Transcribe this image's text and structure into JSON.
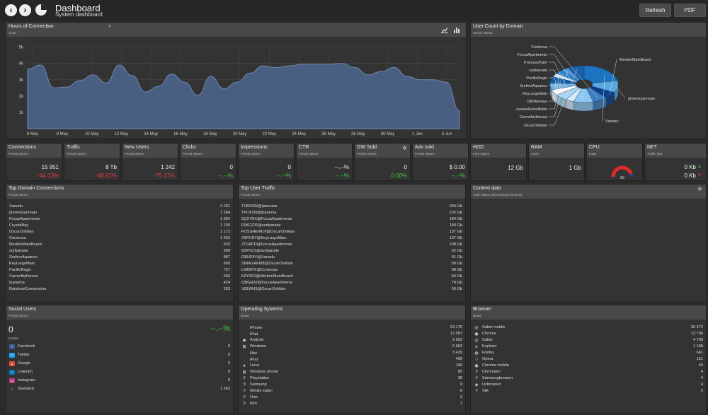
{
  "header": {
    "title": "Dashboard",
    "subtitle": "System dashboard",
    "refresh_label": "Refresh",
    "pdf_label": "PDF"
  },
  "hours_panel": {
    "title": "Hours of Connection",
    "subtitle": "Chart"
  },
  "chart_data": {
    "type": "area",
    "title": "Hours of Connection",
    "x_ticks": [
      "6 May",
      "8 May",
      "10 May",
      "12 May",
      "14 May",
      "16 May",
      "18 May",
      "20 May",
      "22 May",
      "24 May",
      "26 May",
      "28 May",
      "30 May",
      "1 Jun",
      "3 Jun"
    ],
    "y_ticks": [
      "1k",
      "2k",
      "3k",
      "4k",
      "5k"
    ],
    "ylim": [
      0,
      5200
    ],
    "grid": true,
    "color": "#4e6790",
    "x_index": [
      0,
      1,
      2,
      3,
      4,
      5,
      6,
      7,
      8,
      9,
      10,
      11,
      12,
      13,
      14,
      15,
      16,
      17,
      18,
      19,
      20,
      21,
      22,
      23,
      24,
      25,
      26,
      27,
      28,
      29,
      30,
      31,
      32,
      33
    ],
    "values": [
      3650,
      3900,
      2500,
      2550,
      2950,
      3300,
      2800,
      3900,
      3250,
      2250,
      2600,
      3350,
      2850,
      2050,
      3200,
      2450,
      2850,
      3400,
      3850,
      3750,
      3850,
      3950,
      3950,
      3950,
      4000,
      3750,
      3300,
      3500,
      3750,
      3200,
      3000,
      3000,
      2850,
      1100
    ]
  },
  "user_count_panel": {
    "title": "User Count by Domain",
    "subtitle": "Period Values"
  },
  "pie_data": {
    "type": "pie",
    "labels": [
      "Xanadu",
      "phoenicianmain",
      "MeritonMainBeach",
      "Contessa",
      "FocusApartments",
      "PrincessPalm",
      "surfparade",
      "PacificRegis",
      "SurfersAquarius",
      "KeyLargoMain",
      "19thAvenue",
      "AussieResortMain",
      "Carmelbythesea",
      "OscarOnMain"
    ],
    "values": [
      3291,
      1584,
      926,
      1062,
      1384,
      600,
      908,
      757,
      887,
      860,
      500,
      520,
      566,
      1172
    ],
    "colors": [
      "#1c74c0",
      "#5aa8e0",
      "#0b3f8a",
      "#3d7fbf",
      "#8ec7ef",
      "#d7ecf9",
      "#a8d5f2",
      "#ffffff",
      "#6fb2e5",
      "#0f5ca6",
      "#cde6f8",
      "#2a86d0",
      "#4b97d8",
      "#1a60a8"
    ]
  },
  "kpis": [
    {
      "title": "Connections",
      "subtitle": "Period Values",
      "value": "15 951",
      "delta": "-44.13%",
      "delta_class": "kneg",
      "badge": ""
    },
    {
      "title": "Traffic",
      "subtitle": "Period Values",
      "value": "8 Tb",
      "delta": "-48.82%",
      "delta_class": "kneg",
      "badge": ""
    },
    {
      "title": "New Users",
      "subtitle": "Period Values",
      "value": "1 242",
      "delta": "-75.17%",
      "delta_class": "kneg",
      "badge": ""
    },
    {
      "title": "Clicks",
      "subtitle": "Period Values",
      "value": "0",
      "delta": "--.--%",
      "delta_class": "kpos",
      "badge": ""
    },
    {
      "title": "Impressions",
      "subtitle": "Period Values",
      "value": "0",
      "delta": "--.--%",
      "delta_class": "kpos",
      "badge": ""
    },
    {
      "title": "CTR",
      "subtitle": "Period Values",
      "value": "--.--%",
      "delta": "--.--%",
      "delta_class": "kpos",
      "badge": ""
    },
    {
      "title": "GW Sold",
      "subtitle": "Period Values",
      "value": "0",
      "delta": "0.00%",
      "delta_class": "kpos",
      "badge": "gear"
    },
    {
      "title": "Adv sold",
      "subtitle": "Period Values",
      "value": "$ 0.00",
      "delta": "--.--%",
      "delta_class": "kpos",
      "badge": ""
    }
  ],
  "system": {
    "hdd": {
      "title": "HDD",
      "subtitle": "Free Space",
      "value": "12 Gb"
    },
    "ram": {
      "title": "RAM",
      "subtitle": "Used",
      "value": "1 Gb"
    },
    "cpu": {
      "title": "CPU",
      "subtitle": "Load",
      "value": "89",
      "load": 0.89
    },
    "net": {
      "title": "NET",
      "subtitle": "Traffic (bit)",
      "up": "0 Kb",
      "down": "0 Kb"
    }
  },
  "top_domain": {
    "title": "Top Domain Connections",
    "subtitle": "Period Values",
    "rows": [
      [
        "Xanadu",
        "3 291"
      ],
      [
        "phoenicianmain",
        "1 584"
      ],
      [
        "FocusApartments",
        "1 384"
      ],
      [
        "CrystalBay",
        "1 230"
      ],
      [
        "OscarOnMain",
        "1 172"
      ],
      [
        "Contessa",
        "1 062"
      ],
      [
        "MeritonMainBeach",
        "926"
      ],
      [
        "surfparade",
        "908"
      ],
      [
        "SurfersAquarius",
        "887"
      ],
      [
        "KeyLargoMain",
        "860"
      ],
      [
        "PacificRegis",
        "757"
      ],
      [
        "Carmelbythesea",
        "566"
      ],
      [
        "Ipanema",
        "424"
      ],
      [
        "RainbowCommodore",
        "293"
      ]
    ]
  },
  "top_user": {
    "title": "Top User Traffic",
    "subtitle": "Period Values",
    "rows": [
      [
        "T1BSSW@Ipanema",
        "284 Gb"
      ],
      [
        "TPLN1M@Ipanema",
        "232 Gb"
      ],
      [
        "5QX7NX@FocusApartments",
        "184 Gb"
      ],
      [
        "RWGZ26@surfparade",
        "180 Gb"
      ],
      [
        "FOSSHEIM10@OscarOnMain",
        "137 Gb"
      ],
      [
        "S9NVD7@KeyLargoMain",
        "137 Gb"
      ],
      [
        "2TG8PD@FocusApartments",
        "108 Gb"
      ],
      [
        "6DPS21@surfparade",
        "92 Gb"
      ],
      [
        "GBH24V@Xanadu",
        "91 Gb"
      ],
      [
        "SINAGAKI88@OscarOnMain",
        "90 Gb"
      ],
      [
        "LM65PX@Contessa",
        "88 Gb"
      ],
      [
        "6ZYS5Z@MeritonMainBeach",
        "84 Gb"
      ],
      [
        "QBGH32@FocusApartments",
        "74 Gb"
      ],
      [
        "V81WH3@OscarOnMain",
        "69 Gb"
      ]
    ]
  },
  "context": {
    "title": "Context data",
    "subtitle": "Total Values (Discounted Amounts)"
  },
  "social": {
    "title": "Social Users",
    "subtitle": "Period Values",
    "value": "0",
    "delta": "--.--%",
    "detail_label": "Details",
    "rows": [
      [
        "Facebook",
        "0",
        "f",
        "#3b5998"
      ],
      [
        "Twitter",
        "0",
        "t",
        "#1da1f2"
      ],
      [
        "Google",
        "0",
        "g",
        "#dd4b39"
      ],
      [
        "LinkedIn",
        "0",
        "in",
        "#0077b5"
      ],
      [
        "Instagram",
        "0",
        "ig",
        "#c13584"
      ],
      [
        "Standard",
        "1 242",
        "⌂",
        "#333333"
      ]
    ]
  },
  "os": {
    "title": "Operating Systems",
    "subtitle": "Detail",
    "rows": [
      [
        "iPhone",
        "23 170",
        ""
      ],
      [
        "iPad",
        "12 587",
        ""
      ],
      [
        "Android",
        "9 592",
        "☻"
      ],
      [
        "Windows",
        "6 683",
        "⊞"
      ],
      [
        "Mac",
        "3 429",
        ""
      ],
      [
        "iPod",
        "400",
        ""
      ],
      [
        "Linux",
        "106",
        "♦"
      ],
      [
        "Windows phone",
        "85",
        "⊞"
      ],
      [
        "Playstation",
        "38",
        "?"
      ],
      [
        "Samsung",
        "9",
        "?"
      ],
      [
        "Mobile safari",
        "8",
        "?"
      ],
      [
        "Unix",
        "3",
        "?"
      ],
      [
        "Rim",
        "1",
        "?"
      ]
    ]
  },
  "browser": {
    "title": "Browser",
    "subtitle": "Detail",
    "rows": [
      [
        "Safari mobile",
        "35 472",
        "◎"
      ],
      [
        "Chrome",
        "13 796",
        "◉"
      ],
      [
        "Safari",
        "4 709",
        "◎"
      ],
      [
        "Explorer",
        "1 188",
        "ℯ"
      ],
      [
        "Firefox",
        "641",
        "◍"
      ],
      [
        "Opera",
        "151",
        "○"
      ],
      [
        "Chrome mobile",
        "40",
        "◉"
      ],
      [
        "Chromium",
        "4",
        "?"
      ],
      [
        "Samsungbrowser",
        "4",
        "?"
      ],
      [
        "Ucbrowser",
        "4",
        "◈"
      ],
      [
        "Silk",
        "2",
        "?"
      ]
    ]
  }
}
